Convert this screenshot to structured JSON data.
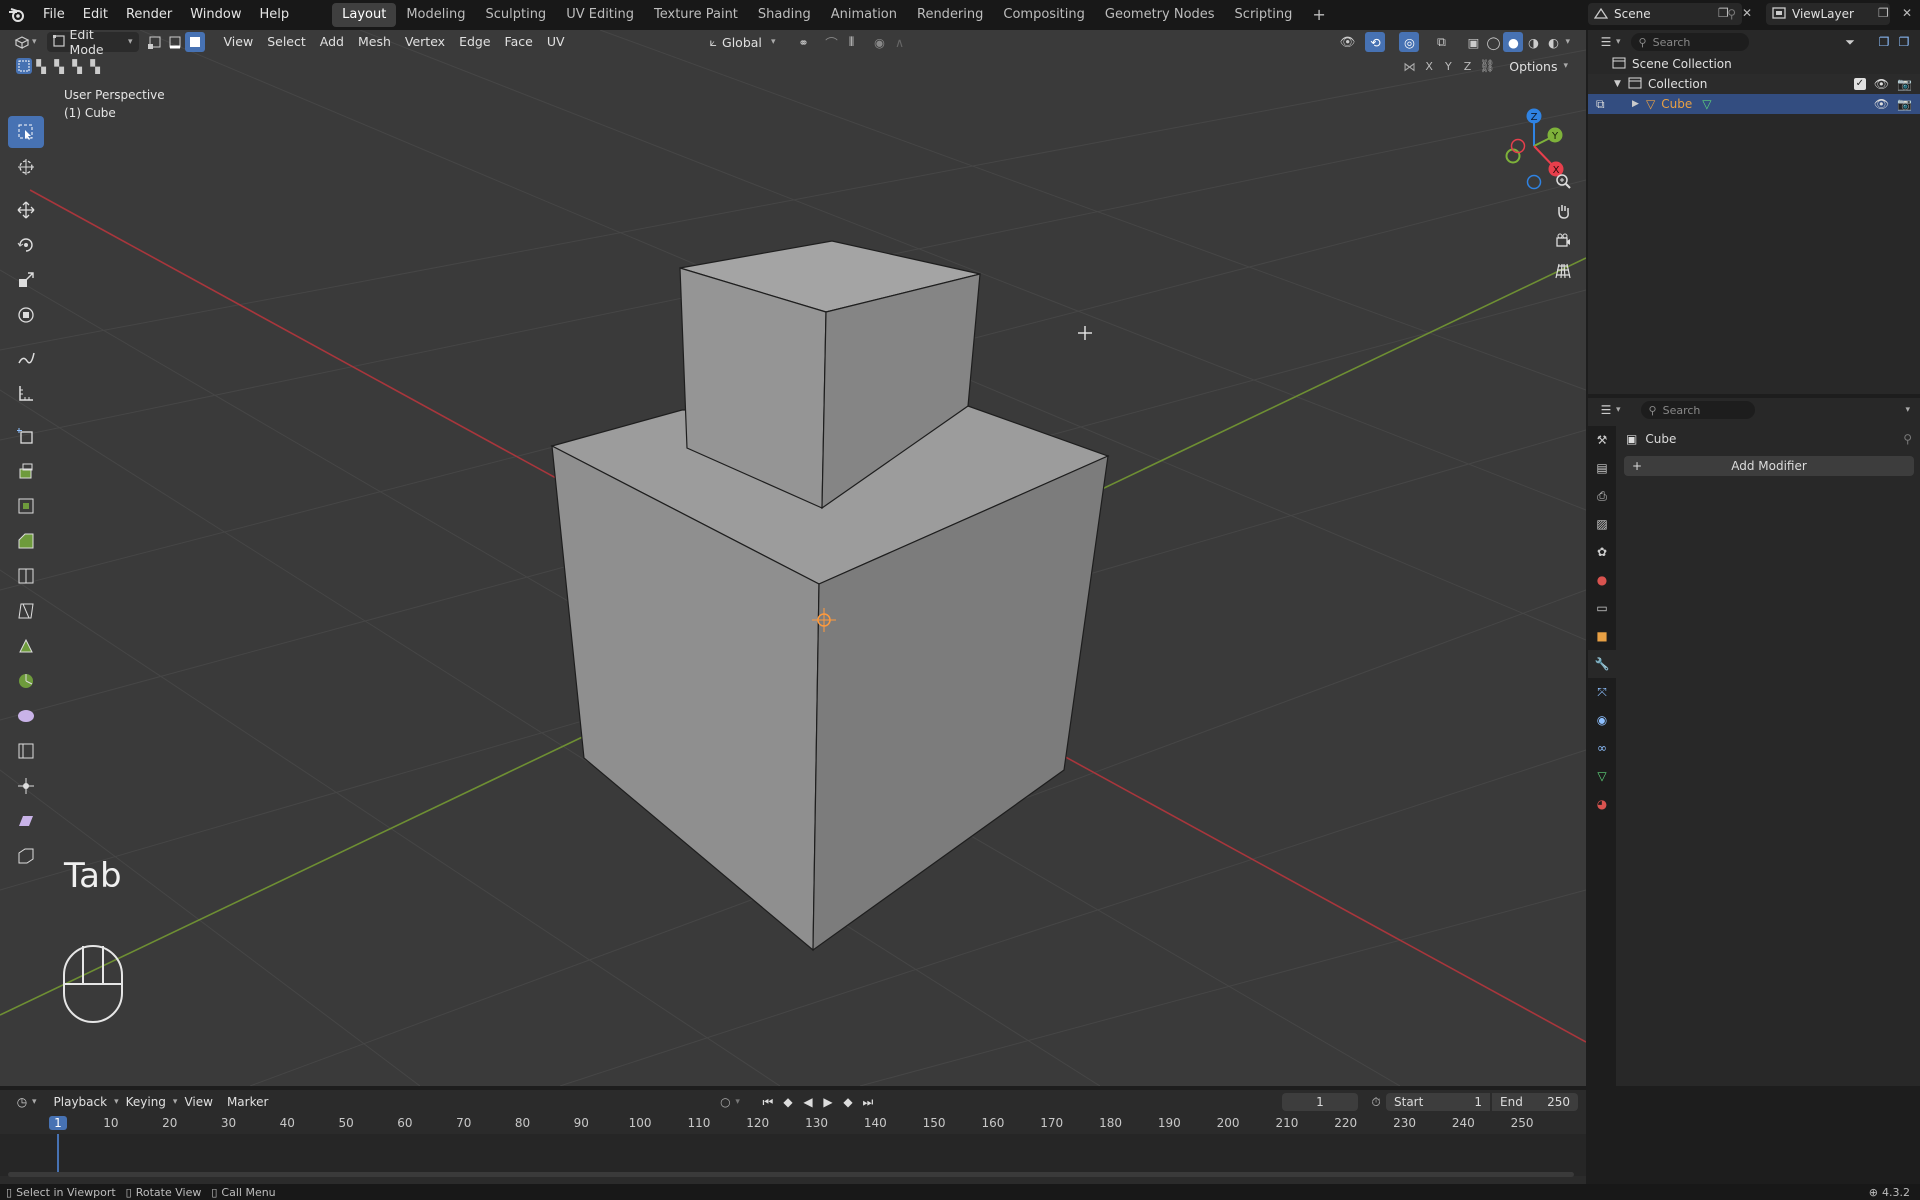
{
  "topbar": {
    "menus": [
      "File",
      "Edit",
      "Render",
      "Window",
      "Help"
    ],
    "workspaces": [
      "Layout",
      "Modeling",
      "Sculpting",
      "UV Editing",
      "Texture Paint",
      "Shading",
      "Animation",
      "Rendering",
      "Compositing",
      "Geometry Nodes",
      "Scripting"
    ],
    "active_workspace": "Layout",
    "scene_label": "Scene",
    "view_layer_label": "ViewLayer"
  },
  "viewport": {
    "mode_label": "Edit Mode",
    "header_menus": [
      "View",
      "Select",
      "Add",
      "Mesh",
      "Vertex",
      "Edge",
      "Face",
      "UV"
    ],
    "transform_orientation": "Global",
    "options_label": "Options",
    "axis_labels": [
      "X",
      "Y",
      "Z"
    ],
    "overlay_title": "User Perspective",
    "overlay_object": "(1) Cube",
    "key_hint": "Tab",
    "gizmo_labels": {
      "x": "X",
      "y": "Y",
      "z": "Z"
    }
  },
  "outliner": {
    "search_placeholder": "Search",
    "scene_collection": "Scene Collection",
    "collection": "Collection",
    "object": "Cube"
  },
  "properties": {
    "search_placeholder": "Search",
    "object_name": "Cube",
    "add_modifier": "Add Modifier"
  },
  "timeline": {
    "menus": [
      "Playback",
      "Keying",
      "View",
      "Marker"
    ],
    "current_frame": "1",
    "start_label": "Start",
    "start_value": "1",
    "end_label": "End",
    "end_value": "250",
    "ruler": [
      "1",
      "10",
      "20",
      "30",
      "40",
      "50",
      "60",
      "70",
      "80",
      "90",
      "100",
      "110",
      "120",
      "130",
      "140",
      "150",
      "160",
      "170",
      "180",
      "190",
      "200",
      "210",
      "220",
      "230",
      "240",
      "250"
    ]
  },
  "statusbar": {
    "hints": [
      "Select in Viewport",
      "Rotate View",
      "Call Menu"
    ],
    "version": "4.3.2"
  },
  "colors": {
    "accent": "#4772b3",
    "x_axis": "#e83f4c",
    "y_axis": "#7eb23a",
    "z_axis": "#2f83e3",
    "object_orange": "#e8a044"
  }
}
